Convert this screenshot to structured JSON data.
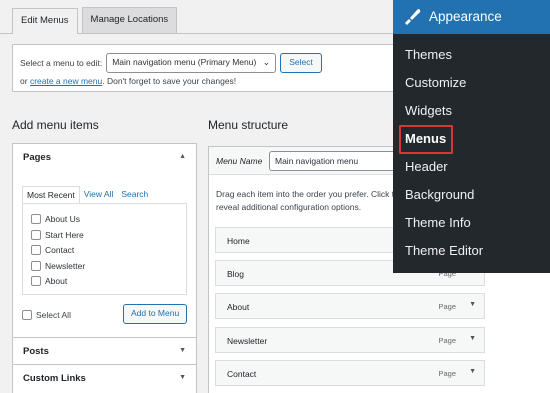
{
  "tabs": {
    "edit": "Edit Menus",
    "manage": "Manage Locations"
  },
  "select_menu": {
    "label": "Select a menu to edit:",
    "value": "Main navigation menu (Primary Menu)",
    "button": "Select",
    "hint_prefix": "or",
    "hint_link": "create a new menu",
    "hint_suffix": ". Don't forget to save your changes!"
  },
  "left": {
    "heading": "Add menu items",
    "pages_title": "Pages",
    "pages_tabs": [
      "Most Recent",
      "View All",
      "Search"
    ],
    "pages": [
      "About Us",
      "Start Here",
      "Contact",
      "Newsletter",
      "About"
    ],
    "select_all": "Select All",
    "add_button": "Add to Menu",
    "posts_title": "Posts",
    "custom_links_title": "Custom Links"
  },
  "structure": {
    "heading": "Menu structure",
    "name_label": "Menu Name",
    "name_value": "Main navigation menu",
    "instructions_1": "Drag each item into the order you prefer. Click t",
    "instructions_2": "reveal additional configuration options.",
    "items": [
      {
        "title": "Home",
        "type": ""
      },
      {
        "title": "Blog",
        "type": "Page"
      },
      {
        "title": "About",
        "type": "Page"
      },
      {
        "title": "Newsletter",
        "type": "Page"
      },
      {
        "title": "Contact",
        "type": "Page"
      }
    ]
  },
  "appearance_menu": {
    "title": "Appearance",
    "items": [
      "Themes",
      "Customize",
      "Widgets",
      "Menus",
      "Header",
      "Background",
      "Theme Info",
      "Theme Editor"
    ],
    "current": "Menus"
  },
  "colors": {
    "accent": "#2271b1",
    "overlay_bg": "#23282d",
    "highlight": "#d63638"
  },
  "icons": {
    "appearance": "paintbrush-icon",
    "collapse": "triangle-up-icon",
    "expand": "triangle-down-icon"
  }
}
